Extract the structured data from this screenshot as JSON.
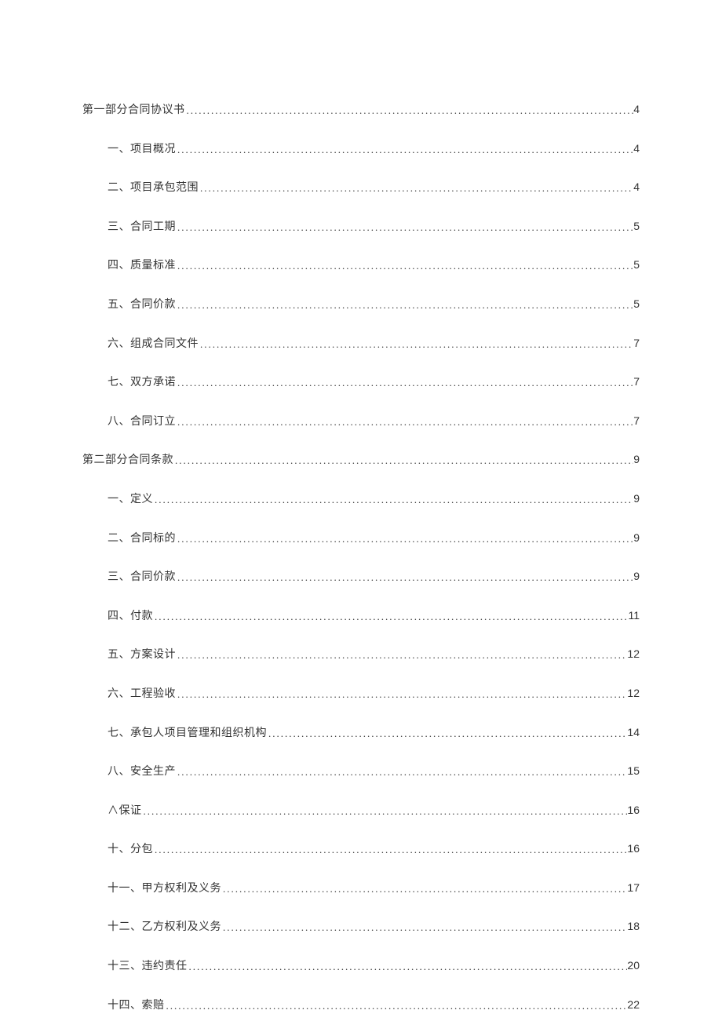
{
  "toc": [
    {
      "level": 0,
      "label": "第一部分合同协议书",
      "page": "4"
    },
    {
      "level": 1,
      "label": "一、项目概况",
      "page": "4"
    },
    {
      "level": 1,
      "label": "二、项目承包范围",
      "page": "4"
    },
    {
      "level": 1,
      "label": "三、合同工期",
      "page": "5"
    },
    {
      "level": 1,
      "label": "四、质量标准",
      "page": "5"
    },
    {
      "level": 1,
      "label": "五、合同价款",
      "page": "5"
    },
    {
      "level": 1,
      "label": "六、组成合同文件",
      "page": "7"
    },
    {
      "level": 1,
      "label": "七、双方承诺",
      "page": "7"
    },
    {
      "level": 1,
      "label": "八、合同订立",
      "page": "7"
    },
    {
      "level": 0,
      "label": "第二部分合同条款",
      "page": "9"
    },
    {
      "level": 1,
      "label": "一、定义",
      "page": "9"
    },
    {
      "level": 1,
      "label": "二、合同标的",
      "page": "9"
    },
    {
      "level": 1,
      "label": "三、合同价款",
      "page": "9"
    },
    {
      "level": 1,
      "label": "四、付款",
      "page": "11"
    },
    {
      "level": 1,
      "label": "五、方案设计",
      "page": "12"
    },
    {
      "level": 1,
      "label": "六、工程验收",
      "page": "12"
    },
    {
      "level": 1,
      "label": "七、承包人项目管理和组织机构",
      "page": "14"
    },
    {
      "level": 1,
      "label": "八、安全生产",
      "page": "15"
    },
    {
      "level": 1,
      "label": "∧保证",
      "page": "16"
    },
    {
      "level": 1,
      "label": "十、分包",
      "page": "16"
    },
    {
      "level": 1,
      "label": "十一、甲方权利及义务",
      "page": "17"
    },
    {
      "level": 1,
      "label": "十二、乙方权利及义务",
      "page": "18"
    },
    {
      "level": 1,
      "label": "十三、违约责任",
      "page": "20"
    },
    {
      "level": 1,
      "label": "十四、索赔",
      "page": "22"
    }
  ]
}
